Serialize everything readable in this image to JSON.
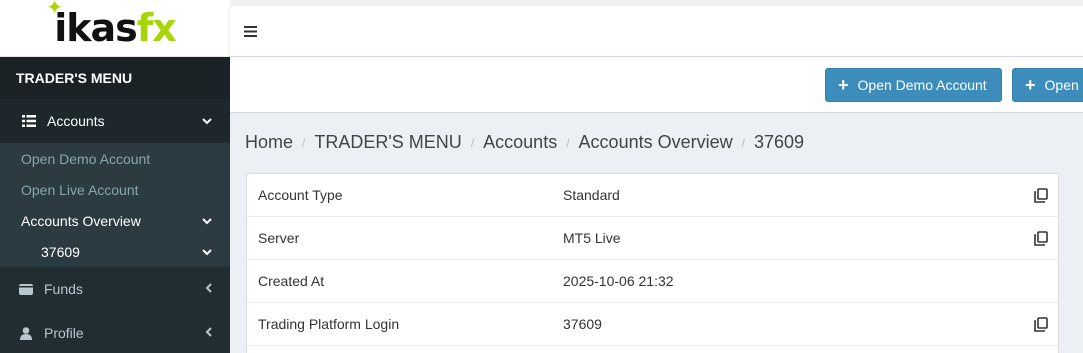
{
  "brand": {
    "logo_main": "ikas",
    "logo_accent": "fx"
  },
  "sidebar": {
    "header": "TRADER'S MENU",
    "accounts_label": "Accounts",
    "sub": {
      "open_demo": "Open Demo Account",
      "open_live": "Open Live Account",
      "overview": "Accounts Overview",
      "account_number": "37609"
    },
    "funds_label": "Funds",
    "profile_label": "Profile"
  },
  "topbar": {
    "menu_icon": "hamburger-icon"
  },
  "actions": {
    "open_demo": "Open Demo Account",
    "open_live": "Open Live Account"
  },
  "breadcrumb": [
    "Home",
    "TRADER'S MENU",
    "Accounts",
    "Accounts Overview",
    "37609"
  ],
  "details": [
    {
      "key": "Account Type",
      "value": "Standard",
      "copy": true
    },
    {
      "key": "Server",
      "value": "MT5 Live",
      "copy": true
    },
    {
      "key": "Created At",
      "value": "2025-10-06 21:32",
      "copy": false
    },
    {
      "key": "Trading Platform Login",
      "value": "37609",
      "copy": true
    }
  ],
  "colors": {
    "accent": "#3c8dbc",
    "sidebar": "#222d32",
    "brand_green": "#a6d608"
  }
}
